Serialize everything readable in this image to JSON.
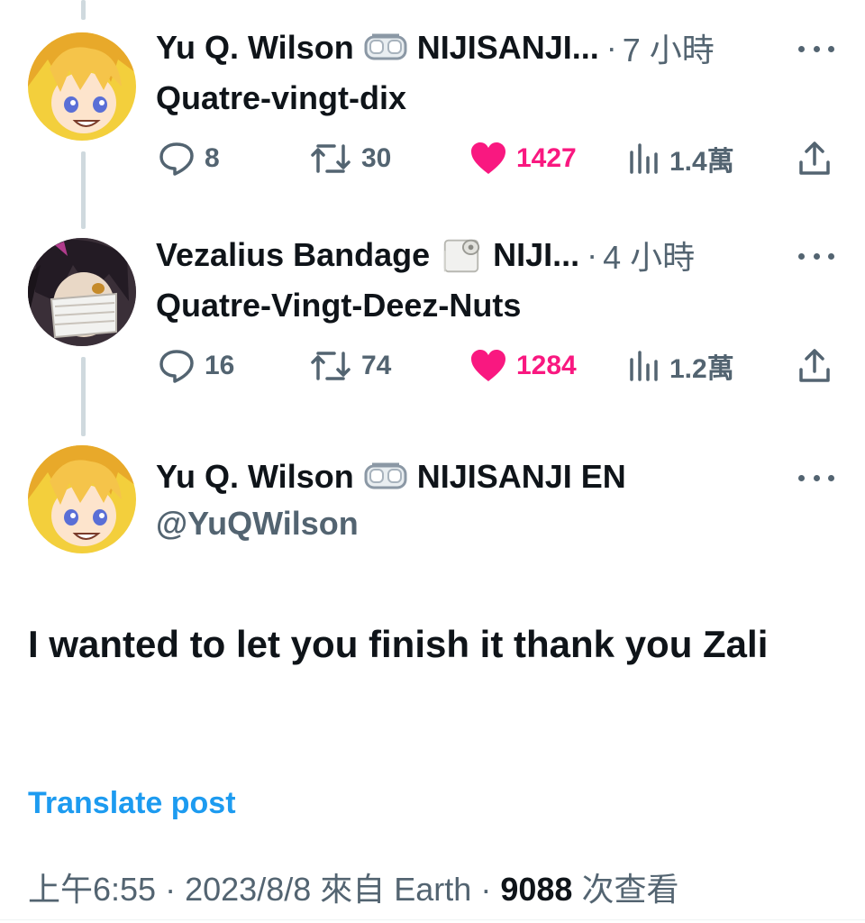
{
  "replies": [
    {
      "display_name": "Yu Q. Wilson",
      "badge_icon": "goggles-emoji",
      "org": "NIJISANJI...",
      "separator": "·",
      "time": "7 小時",
      "text": "Quatre-vingt-dix",
      "replies_count": "8",
      "retweets_count": "30",
      "likes_count": "1427",
      "views_count": "1.4萬"
    },
    {
      "display_name": "Vezalius Bandage",
      "badge_icon": "toilet-paper-emoji",
      "org": "NIJI...",
      "separator": "·",
      "time": "4 小時",
      "text": "Quatre-Vingt-Deez-Nuts",
      "replies_count": "16",
      "retweets_count": "74",
      "likes_count": "1284",
      "views_count": "1.2萬"
    }
  ],
  "main_post": {
    "display_name": "Yu Q. Wilson",
    "badge_icon": "goggles-emoji",
    "org": "NIJISANJI EN",
    "handle": "@YuQWilson",
    "text": "I wanted to let you finish it thank you Zali",
    "translate_label": "Translate post",
    "time": "上午6:55",
    "sep1": "·",
    "date": "2023/8/8",
    "source": "來自 Earth",
    "sep2": "·",
    "views": "9088",
    "views_label": "次查看"
  },
  "colors": {
    "like_pink": "#f91880",
    "link_blue": "#1d9bf0",
    "muted": "#536471",
    "text": "#0f1419",
    "thread_line": "#cfd9de"
  }
}
